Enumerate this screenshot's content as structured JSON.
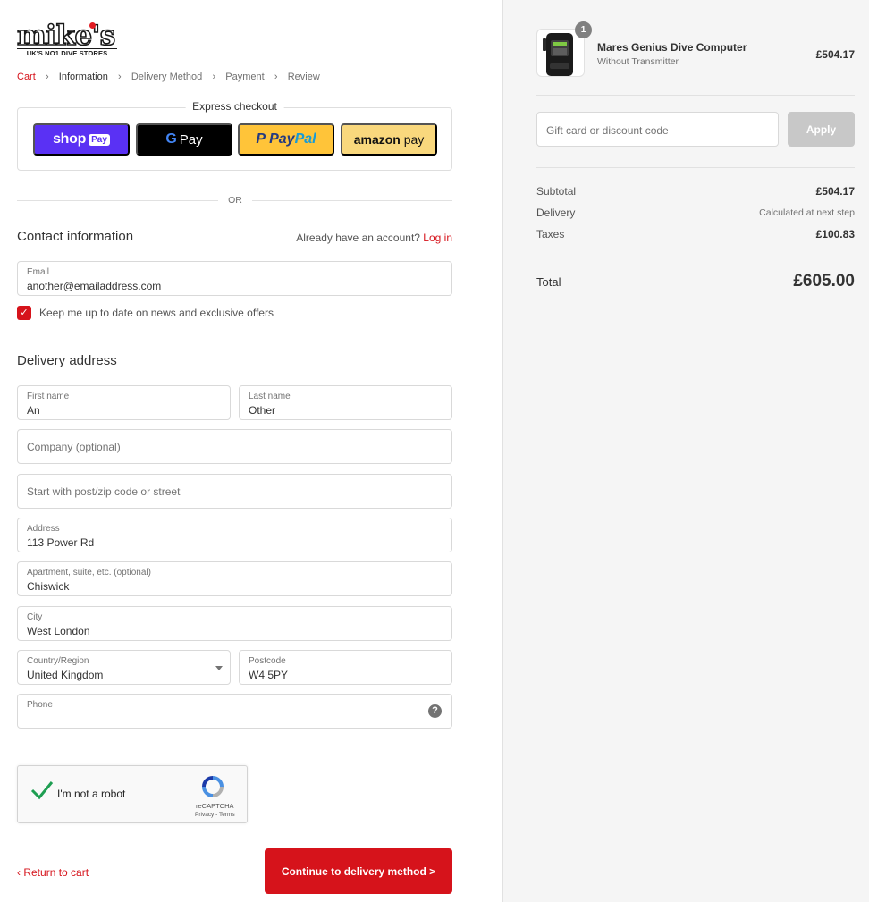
{
  "brand": {
    "logo_word": "mike's",
    "logo_tagline": "UK'S NO1 DIVE STORES",
    "accent_color": "#d6131b"
  },
  "breadcrumb": [
    {
      "label": "Cart",
      "state": "link"
    },
    {
      "label": "Information",
      "state": "active"
    },
    {
      "label": "Delivery Method",
      "state": "inactive"
    },
    {
      "label": "Payment",
      "state": "inactive"
    },
    {
      "label": "Review",
      "state": "inactive"
    }
  ],
  "express": {
    "title": "Express checkout",
    "shop_pay": {
      "text": "shop",
      "badge": "Pay"
    },
    "google_pay": {
      "g": "G",
      "text": "Pay"
    },
    "paypal": {
      "icon": "P",
      "pay": "Pay",
      "pal": "Pal"
    },
    "amazon_pay": {
      "amazon": "amazon",
      "pay": " pay"
    }
  },
  "or_text": "OR",
  "contact": {
    "heading": "Contact information",
    "account_prompt": "Already have an account?",
    "login_link": "Log in",
    "email_label": "Email",
    "email_value": "another@emailaddress.com",
    "newsletter_label": "Keep me up to date on news and exclusive offers",
    "newsletter_checked": true
  },
  "delivery": {
    "heading": "Delivery address",
    "first_name": {
      "label": "First name",
      "value": "An"
    },
    "last_name": {
      "label": "Last name",
      "value": "Other"
    },
    "company": {
      "placeholder": "Company (optional)"
    },
    "lookup": {
      "placeholder": "Start with post/zip code or street"
    },
    "address": {
      "label": "Address",
      "value": "113 Power Rd"
    },
    "apartment": {
      "label": "Apartment, suite, etc. (optional)",
      "value": "Chiswick"
    },
    "city": {
      "label": "City",
      "value": "West London"
    },
    "country": {
      "label": "Country/Region",
      "value": "United Kingdom"
    },
    "postcode": {
      "label": "Postcode",
      "value": "W4 5PY"
    },
    "phone": {
      "label": "Phone",
      "value": "",
      "help_icon": "question-circle-icon"
    }
  },
  "captcha": {
    "label": "I'm not a robot",
    "brand": "reCAPTCHA",
    "terms": "Privacy - Terms"
  },
  "nav": {
    "return_label": "Return to cart",
    "continue_label": "Continue to delivery method >"
  },
  "order": {
    "product_name": "Mares Genius Dive Computer",
    "product_variant": "Without Transmitter",
    "product_price": "£504.17",
    "quantity": "1",
    "discount_placeholder": "Gift card or discount code",
    "apply_label": "Apply",
    "subtotal_label": "Subtotal",
    "subtotal_value": "£504.17",
    "delivery_label": "Delivery",
    "delivery_value": "Calculated at next step",
    "taxes_label": "Taxes",
    "taxes_value": "£100.83",
    "total_label": "Total",
    "total_value": "£605.00"
  }
}
